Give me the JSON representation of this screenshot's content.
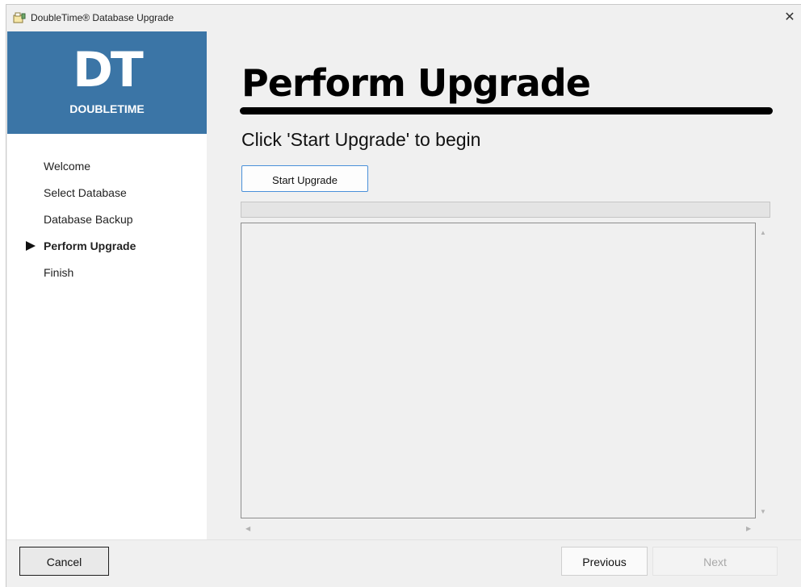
{
  "window": {
    "title": "DoubleTime® Database Upgrade",
    "close_glyph": "✕"
  },
  "logo": {
    "monogram": "DT",
    "wordmark": "DOUBLETIME",
    "brand_color": "#3b75a6"
  },
  "steps": [
    {
      "label": "Welcome",
      "active": false
    },
    {
      "label": "Select Database",
      "active": false
    },
    {
      "label": "Database Backup",
      "active": false
    },
    {
      "label": "Perform Upgrade",
      "active": true
    },
    {
      "label": "Finish",
      "active": false
    }
  ],
  "main": {
    "heading": "Perform Upgrade",
    "subtitle": "Click 'Start Upgrade' to begin",
    "start_button": "Start Upgrade",
    "progress_fraction": 0,
    "log_text": ""
  },
  "footer": {
    "cancel": "Cancel",
    "previous": "Previous",
    "next": "Next"
  },
  "icons": {
    "app": "installer-icon",
    "current_step": "play-arrow-icon"
  }
}
